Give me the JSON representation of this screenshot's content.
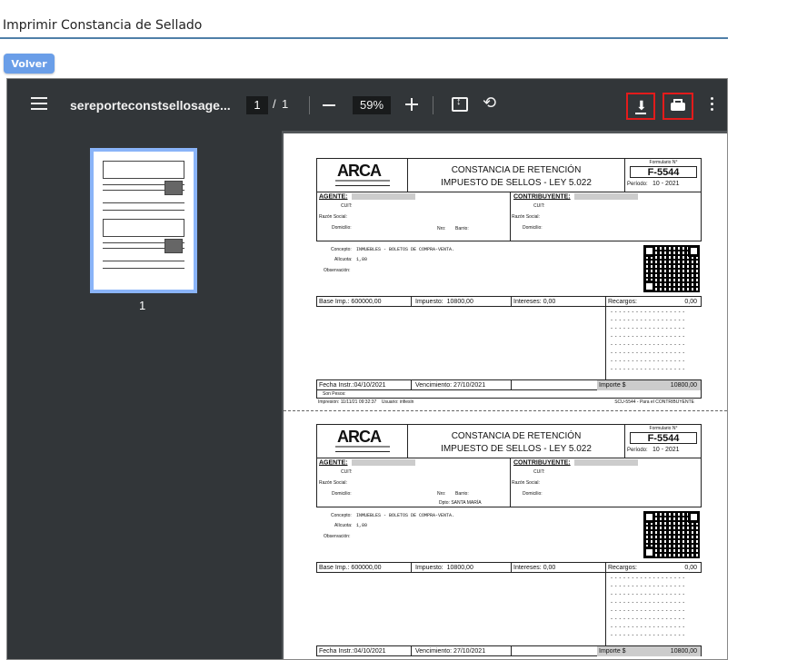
{
  "page": {
    "title": "Imprimir Constancia de Sellado",
    "back_label": "Volver"
  },
  "toolbar": {
    "menu_icon": "hamburger-menu-icon",
    "filename": "sereporteconstsellosage...",
    "current_page": "1",
    "page_sep": "/",
    "total_pages": "1",
    "zoom": "59%",
    "download_icon": "download-icon",
    "print_icon": "print-icon",
    "more_icon": "more-vert-icon"
  },
  "sidebar": {
    "thumb_label": "1"
  },
  "form": {
    "brand": "ARCA",
    "title_line1": "CONSTANCIA DE RETENCIÓN",
    "title_line2": "IMPUESTO DE SELLOS - LEY 5.022",
    "form_label": "Formulario N°",
    "form_number": "F-5544",
    "period_label": "Período:",
    "period_value": "10  -  2021",
    "agente": "AGENTE:",
    "contribuyente": "CONTRIBUYENTE:",
    "cuit": "CUIT:",
    "razon": "Razón Social:",
    "domicilio": "Domicilio:",
    "nro": "Nro:",
    "barrio": "Barrio:",
    "dpto": "Dpto: SANTA MARÍA",
    "concepto_label": "Concepto:",
    "concepto_value": "INMUEBLES - BOLETOS DE COMPRA-VENTA.",
    "alicuota_label": "Alícuota:",
    "alicuota_value": "1,80",
    "observacion": "Observación:",
    "base_label": "Base Imp.:",
    "base_value": "600000,00",
    "impuesto_label": "Impuesto:",
    "impuesto_value": "10800,00",
    "intereses_label": "Intereses:",
    "intereses_value": "0,00",
    "recargos_label": "Recargos:",
    "recargos_value": "0,00",
    "dashes": "- - - - - - - - - - - - - - - - - -",
    "fecha_label": "Fecha Instr.:",
    "fecha_value": "04/10/2021",
    "venc_label": "Vencimiento:",
    "venc_value": "27/10/2021",
    "importe_label": "Importe $",
    "importe_value": "10800,00",
    "son_pesos": "Son Pesos:",
    "impresion": "Impresión: 11/11/21  09:32:37",
    "usuario": "Usuario: infiesln",
    "copy_label": "SCU-5544 - Para el CONTRIBUYENTE"
  }
}
